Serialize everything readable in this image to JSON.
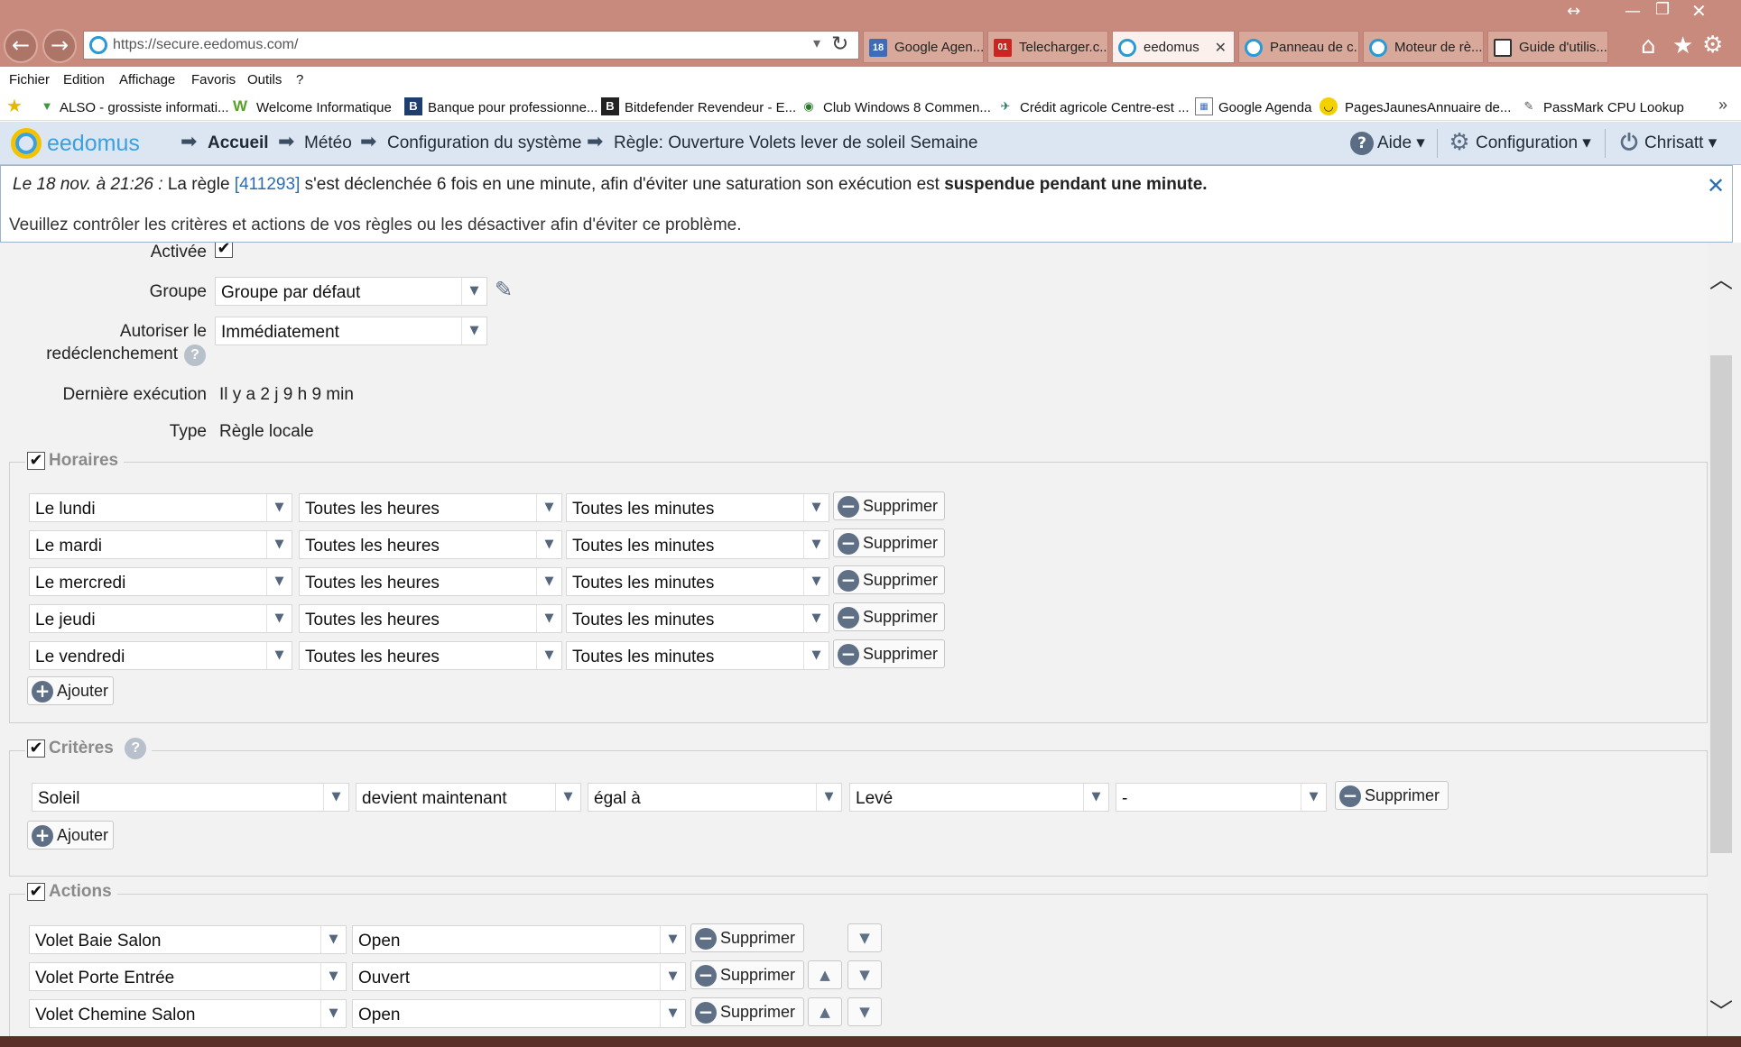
{
  "browser": {
    "url": "https://secure.eedomus.com/",
    "tabs": [
      {
        "label": "Google Agen...",
        "icon": "calendar-icon",
        "badge": "18"
      },
      {
        "label": "Telecharger.c...",
        "icon": "01net-icon",
        "badge": "01"
      },
      {
        "label": "eedomus",
        "icon": "eedomus-icon",
        "close": "✕"
      },
      {
        "label": "Panneau de c...",
        "icon": "eedomus-icon"
      },
      {
        "label": "Moteur de rè...",
        "icon": "eedomus-icon"
      },
      {
        "label": "Guide d'utilis...",
        "icon": "document-icon"
      }
    ],
    "menu": [
      "Fichier",
      "Edition",
      "Affichage",
      "Favoris",
      "Outils",
      "?"
    ],
    "bookmarks": [
      {
        "label": "ALSO - grossiste informati...",
        "icon": "also-icon"
      },
      {
        "label": "Welcome Informatique",
        "icon": "w-icon"
      },
      {
        "label": "Banque pour professionne...",
        "icon": "bank-icon"
      },
      {
        "label": "Bitdefender Revendeur - E...",
        "icon": "bitdefender-icon"
      },
      {
        "label": "Club Windows 8 Commen...",
        "icon": "club-icon"
      },
      {
        "label": "Crédit agricole Centre-est ...",
        "icon": "ca-icon"
      },
      {
        "label": "Google Agenda",
        "icon": "calendar-icon"
      },
      {
        "label": "PagesJaunes",
        "icon": "pj-icon"
      },
      {
        "label": "Annuaire de...",
        "icon": "none"
      },
      {
        "label": "PassMark CPU Lookup",
        "icon": "passmark-icon"
      }
    ]
  },
  "app": {
    "logo": "eedomus",
    "breadcrumbs": [
      "Accueil",
      "Météo",
      "Configuration du système",
      "Règle: Ouverture Volets lever de soleil Semaine"
    ],
    "help": "Aide",
    "config": "Configuration",
    "user": "Chrisatt"
  },
  "notification": {
    "date": "Le 18 nov. à 21:26 :",
    "pre": "La règle",
    "rule_id": "[411293]",
    "mid": "s'est déclenchée 6 fois en une minute, afin d'éviter une saturation son exécution est",
    "bold": "suspendue pendant une minute.",
    "line2": "Veuillez contrôler les critères et actions de vos règles ou les désactiver afin d'éviter ce problème.",
    "close": "✕"
  },
  "form": {
    "activated_label": "Activée",
    "group_label": "Groupe",
    "group_value": "Groupe par défaut",
    "retrigger_label_1": "Autoriser le",
    "retrigger_label_2": "redéclenchement",
    "retrigger_value": "Immédiatement",
    "last_exec_label": "Dernière exécution",
    "last_exec_value": "Il y a 2 j 9 h 9 min",
    "type_label": "Type",
    "type_value": "Règle locale"
  },
  "horaires": {
    "title": "Horaires",
    "rows": [
      {
        "day": "Le lundi",
        "hours": "Toutes les heures",
        "minutes": "Toutes les minutes"
      },
      {
        "day": "Le mardi",
        "hours": "Toutes les heures",
        "minutes": "Toutes les minutes"
      },
      {
        "day": "Le mercredi",
        "hours": "Toutes les heures",
        "minutes": "Toutes les minutes"
      },
      {
        "day": "Le jeudi",
        "hours": "Toutes les heures",
        "minutes": "Toutes les minutes"
      },
      {
        "day": "Le vendredi",
        "hours": "Toutes les heures",
        "minutes": "Toutes les minutes"
      }
    ],
    "add": "Ajouter",
    "delete": "Supprimer"
  },
  "criteres": {
    "title": "Critères",
    "row": {
      "device": "Soleil",
      "condition": "devient maintenant",
      "operator": "égal à",
      "value": "Levé",
      "extra": "-"
    },
    "add": "Ajouter",
    "delete": "Supprimer"
  },
  "actions": {
    "title": "Actions",
    "rows": [
      {
        "device": "Volet Baie Salon",
        "value": "Open"
      },
      {
        "device": "Volet Porte Entrée",
        "value": "Ouvert"
      },
      {
        "device": "Volet Chemine Salon",
        "value": "Open"
      }
    ],
    "delete": "Supprimer"
  },
  "colors": {
    "accent": "#3aa0e0",
    "chrome": "#c88a7c",
    "header": "#dce6f2",
    "link": "#2b6cb6"
  }
}
